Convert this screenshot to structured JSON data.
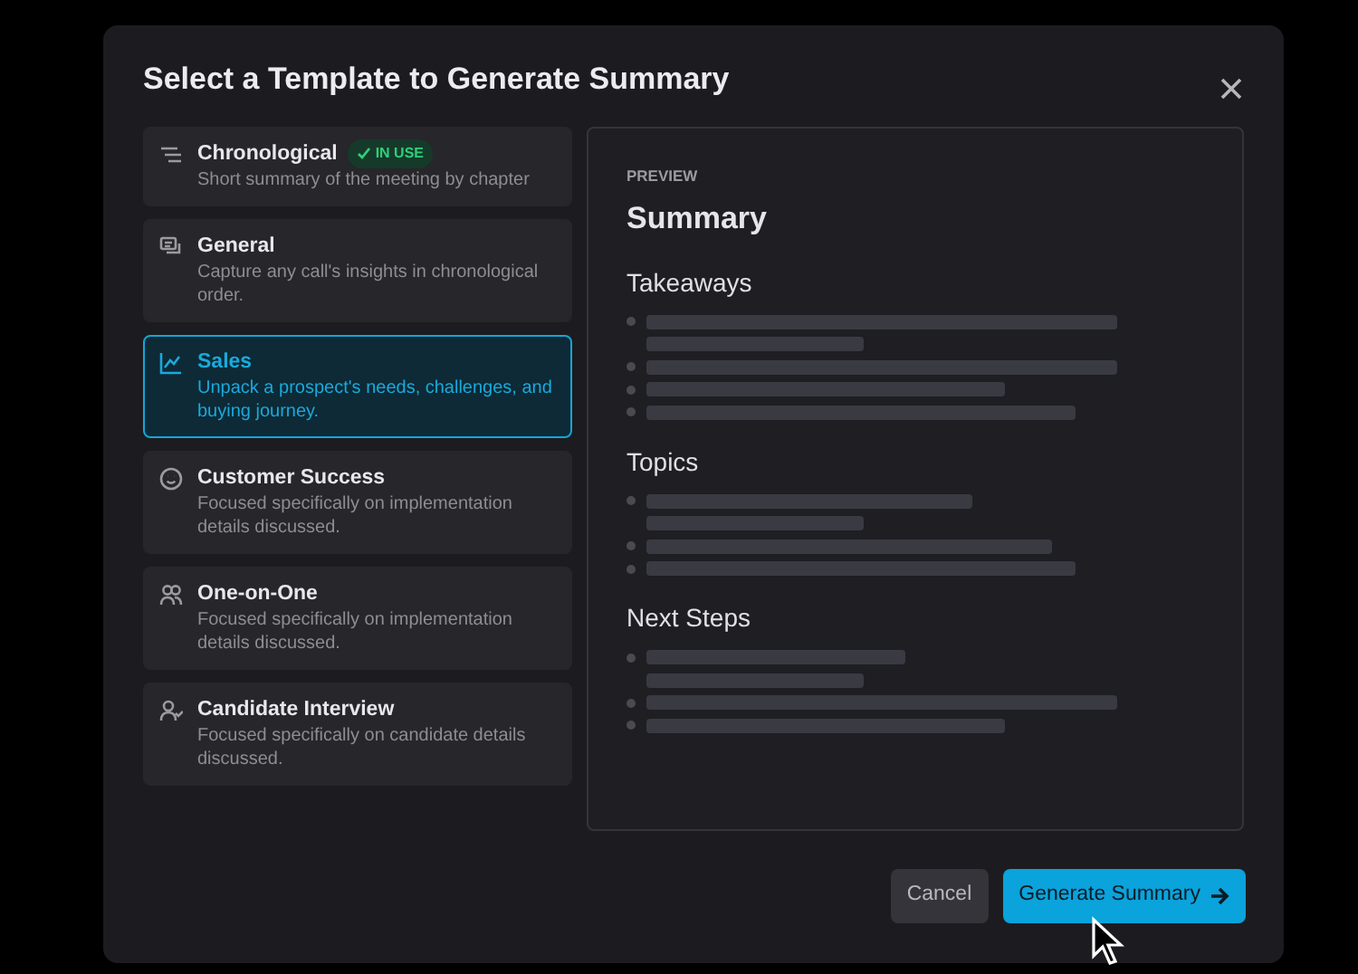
{
  "dialog": {
    "title": "Select a Template to Generate Summary"
  },
  "templates": [
    {
      "name": "Chronological",
      "badge": "IN USE",
      "description": "Short summary of the meeting by chapter",
      "selected": false
    },
    {
      "name": "General",
      "description": "Capture any call's insights in chronological order.",
      "selected": false
    },
    {
      "name": "Sales",
      "description": "Unpack a prospect's needs, challenges, and buying journey.",
      "selected": true
    },
    {
      "name": "Customer Success",
      "description": "Focused specifically on implementation details discussed.",
      "selected": false
    },
    {
      "name": "One-on-One",
      "description": "Focused specifically on implementation details discussed.",
      "selected": false
    },
    {
      "name": "Candidate Interview",
      "description": "Focused specifically on candidate details discussed.",
      "selected": false
    }
  ],
  "preview": {
    "label": "PREVIEW",
    "title": "Summary",
    "sections": [
      "Takeaways",
      "Topics",
      "Next Steps"
    ]
  },
  "buttons": {
    "cancel": "Cancel",
    "confirm": "Generate Summary"
  }
}
